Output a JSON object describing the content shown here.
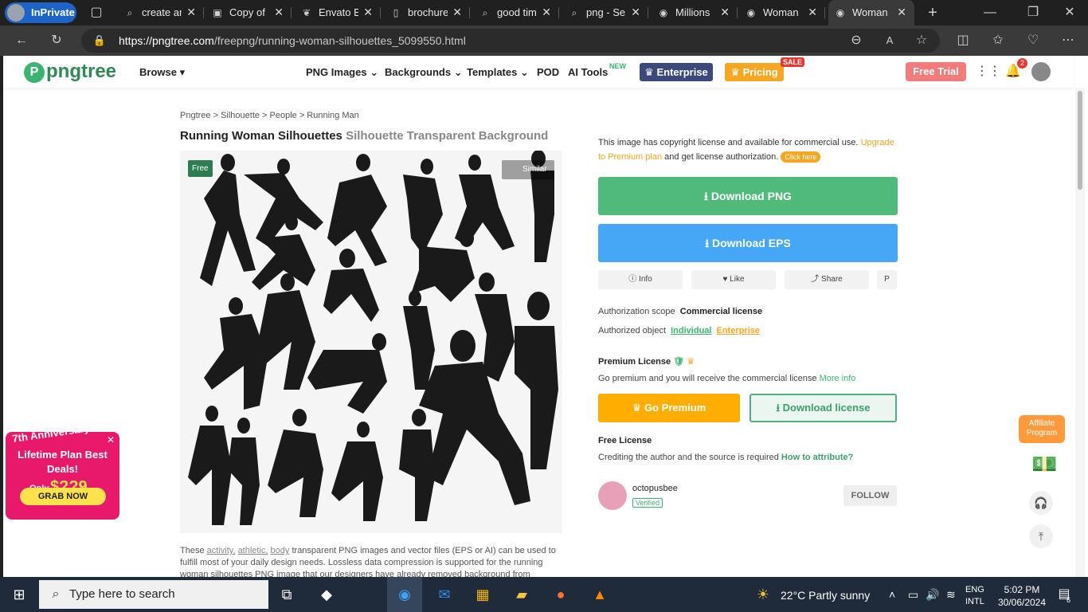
{
  "browser": {
    "inprivate": "InPrivate",
    "tabs": [
      {
        "title": "create ar",
        "icon": "search-icon"
      },
      {
        "title": "Copy of",
        "icon": "canva-icon"
      },
      {
        "title": "Envato E",
        "icon": "leaf-icon"
      },
      {
        "title": "brochure",
        "icon": "document-icon"
      },
      {
        "title": "good tim",
        "icon": "search-icon"
      },
      {
        "title": "png - Se",
        "icon": "search-icon"
      },
      {
        "title": "Millions",
        "icon": "pngtree-icon"
      },
      {
        "title": "Woman",
        "icon": "pngtree-icon"
      },
      {
        "title": "Woman",
        "icon": "pngtree-icon"
      }
    ],
    "url_host": "https://pngtree.com",
    "url_path": "/freepng/running-woman-silhouettes_5099550.html"
  },
  "nav": {
    "logo": "pngtree",
    "browse": "Browse ▾",
    "items": [
      "PNG Images",
      "Backgrounds",
      "Templates",
      "POD",
      "AI Tools"
    ],
    "new_badge": "NEW",
    "enterprise": "Enterprise",
    "pricing": "Pricing",
    "sale": "SALE",
    "free_trial": "Free Trial",
    "notif_count": "2"
  },
  "breadcrumb": "Pngtree > Silhouette > People > Running Man",
  "title_main": "Running Woman Silhouettes",
  "title_sub": "Silhouette Transparent Background",
  "image": {
    "free": "Free",
    "similar": "Similar"
  },
  "description": {
    "pre": "These",
    "tags": [
      "activity,",
      "athletic,",
      "body"
    ],
    "text": "transparent PNG images and vector files (EPS or AI) can be used to fulfill most of your daily design needs. Lossless data compression is supported for the running woman silhouettes PNG image that our designers have already removed background from images. Download"
  },
  "license": {
    "text": "This image has copyright license and available for commercial use.",
    "upgrade": "Upgrade to Premium plan",
    "text2": "and get license authorization.",
    "click": "Click here"
  },
  "download_png": "Download PNG",
  "download_eps": "Download EPS",
  "small_buttons": [
    "Info",
    "Like",
    "Share"
  ],
  "auth_scope_label": "Authorization scope",
  "auth_scope_value": "Commercial license",
  "auth_object_label": "Authorized object",
  "auth_individual": "Individual",
  "auth_enterprise": "Enterprise",
  "premium_title": "Premium License",
  "premium_text": "Go premium and you will receive the commercial license",
  "premium_more": "More info",
  "go_premium": "Go Premium",
  "download_license": "Download license",
  "free_title": "Free License",
  "free_text": "Crediting the author and the source is required",
  "free_link": "How to attribute?",
  "author": {
    "name": "octopusbee",
    "verified": "Verified",
    "follow": "FOLLOW"
  },
  "promo": {
    "head": "7th Anniversary!",
    "main": "Lifetime Plan Best Deals!",
    "only": "Only",
    "price": "$??9",
    "grab": "GRAB NOW"
  },
  "affiliate": "Affiliate Program",
  "taskbar": {
    "search": "Type here to search",
    "weather": "22°C  Partly sunny",
    "lang1": "ENG",
    "lang2": "INTL",
    "time": "5:02 PM",
    "date": "30/06/2024",
    "notif": "6"
  }
}
